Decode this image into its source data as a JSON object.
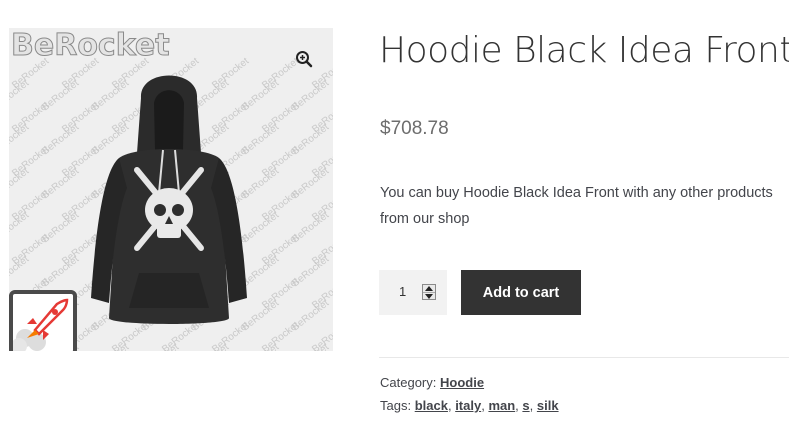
{
  "gallery": {
    "watermark_brand": "BeRocket",
    "watermark_repeat": "BeRocket",
    "zoom_icon": "magnifier-plus-icon",
    "thumbnail_icon": "rocket-icon"
  },
  "product": {
    "title": "Hoodie Black Idea Front",
    "price": "$708.78",
    "description": "You can buy Hoodie Black Idea Front with any other products from our shop"
  },
  "cart": {
    "quantity": "1",
    "add_label": "Add to cart"
  },
  "meta": {
    "category_label": "Category:",
    "category": "Hoodie",
    "tags_label": "Tags:",
    "tags": [
      "black",
      "italy",
      "man",
      "s",
      "silk"
    ]
  },
  "colors": {
    "button_bg": "#333333",
    "button_text": "#ffffff",
    "title": "#333333",
    "price": "#6d6d6d"
  }
}
